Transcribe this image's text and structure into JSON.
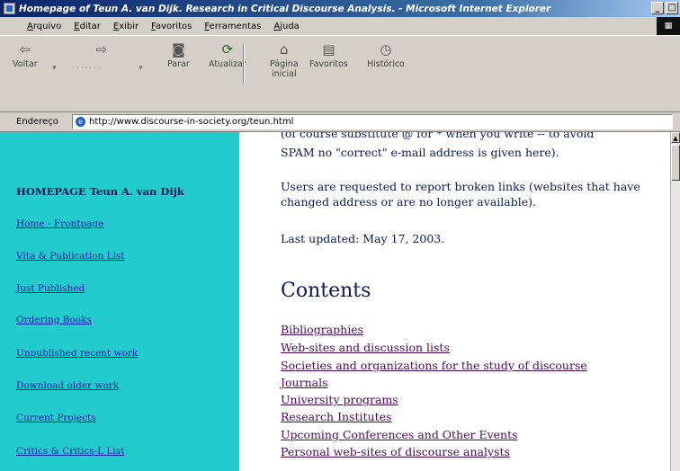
{
  "window": {
    "title": "Homepage of Teun A. van Dijk. Research in Critical Discourse Analysis. - Microsoft Internet Explorer",
    "minimize": "_",
    "maximize": "□",
    "close": "×"
  },
  "menubar": {
    "items": [
      {
        "label_first": "A",
        "label_rest": "rquivo"
      },
      {
        "label_first": "E",
        "label_rest": "ditar"
      },
      {
        "label_first": "E",
        "label_rest": "xibir"
      },
      {
        "label_first": "F",
        "label_rest": "avoritos"
      },
      {
        "label_first": "F",
        "label_rest": "erramentas"
      },
      {
        "label_first": "A",
        "label_rest": "juda"
      }
    ]
  },
  "toolbar": {
    "back": {
      "label": "Voltar",
      "icon": "back-arrow-icon"
    },
    "forward": {
      "icon": "forward-arrow-icon"
    },
    "stop": {
      "label": "Parar",
      "icon": "stop-icon"
    },
    "refresh": {
      "label": "Atualizar",
      "icon": "refresh-icon"
    },
    "home": {
      "label_line1": "Página",
      "label_line2": "inicial",
      "icon": "home-icon"
    },
    "favorites": {
      "label": "Favoritos",
      "icon": "favorites-icon"
    },
    "history": {
      "label": "Histórico",
      "icon": "history-icon"
    }
  },
  "address": {
    "label": "Endereço",
    "url": "http://www.discourse-in-society.org/teun.html"
  },
  "sidebar": {
    "title": "HOMEPAGE Teun A. van Dijk",
    "links": [
      "Home - Frontpage",
      "Vita & Publication List",
      "Just Published",
      "Ordering Books",
      "Unpublished recent work",
      "Download older work",
      "Current Projects",
      "Critics & Critics-L List"
    ]
  },
  "content": {
    "top_fragment_line1": "(of course substitute @ for * when you write -- to avoid",
    "top_fragment_line2": "SPAM no \"correct\" e-mail address is given here).",
    "broken_links_note": "Users are requested to report broken links (websites that have changed address or are no longer available).",
    "last_updated": "Last updated: May 17, 2003.",
    "contents_heading": "Contents",
    "toc": [
      "Bibliographies",
      "Web-sites and discussion lists",
      "Societies and organizations for the study of discourse",
      "Journals",
      "University programs",
      "Research Institutes",
      "Upcoming Conferences and Other Events",
      "Personal web-sites of discourse analysts"
    ]
  },
  "colors": {
    "sidebar_bg": "#22cccc",
    "link": "#1a1ab0",
    "visited_link": "#4a0a5a",
    "text": "#0a1a5a"
  }
}
